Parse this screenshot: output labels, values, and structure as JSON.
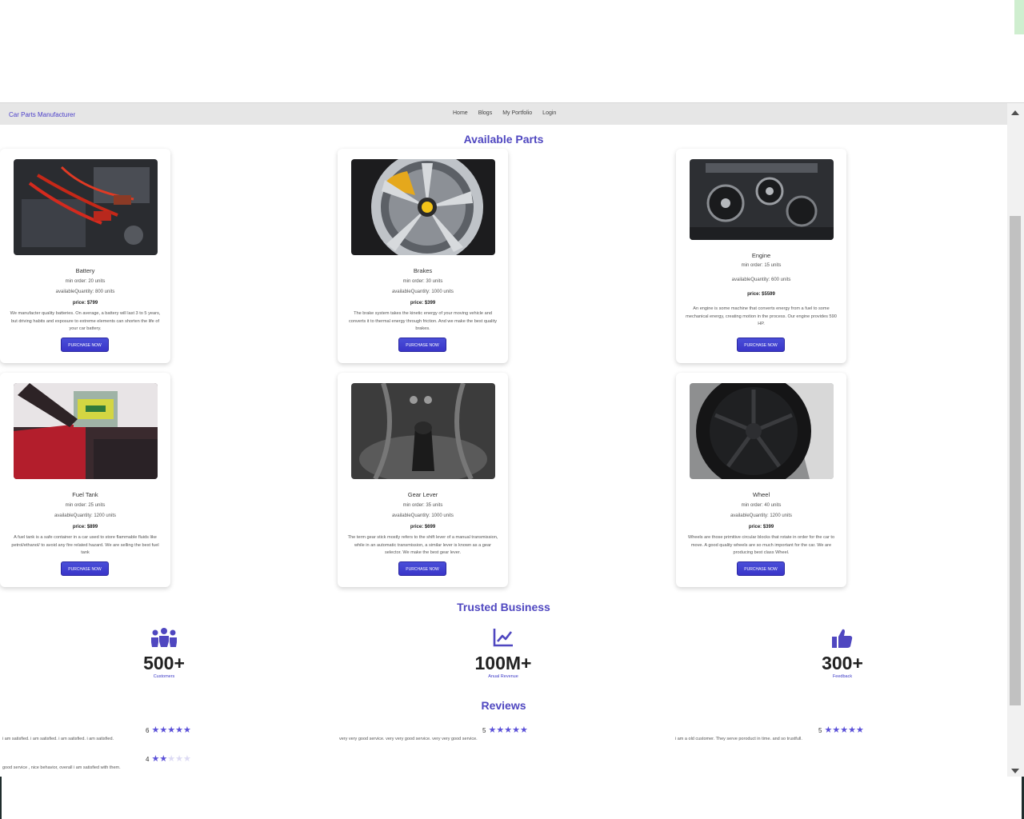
{
  "nav": {
    "brand": "Car Parts Manufacturer",
    "links": [
      "Home",
      "Blogs",
      "My Portfolio",
      "Login"
    ]
  },
  "parts_section": {
    "title": "Available Parts"
  },
  "parts": [
    {
      "name": "Battery",
      "min_order": "min order: 20 units",
      "available": "availableQuantity: 800 units",
      "price": "price: $799",
      "desc": "We manufacter quality batteries. On average, a battery will last 3 to 5 years, but driving habits and exposure to extreme elements can shorten the life of your car battery.",
      "button": "PURCHASE NOW"
    },
    {
      "name": "Brakes",
      "min_order": "min order: 30 units",
      "available": "availableQuantity: 1000 units",
      "price": "price: $399",
      "desc": "The brake system takes the kinetic energy of your moving vehicle and converts it to thermal energy through friction. And we make the best quality brakes.",
      "button": "PURCHASE NOW"
    },
    {
      "name": "Engine",
      "min_order": "min order: 15 units",
      "available": "availableQuantity: 600 units",
      "price": "price: $5599",
      "desc": "An engine is some machine that converts energy from a fuel to some mechanical energy, creating motion in the process. Our engine provides 590 HP.",
      "button": "PURCHASE NOW"
    },
    {
      "name": "Fuel Tank",
      "min_order": "min order: 25 units",
      "available": "availableQuantity: 1200 units",
      "price": "price: $899",
      "desc": "A fuel tank is a safe container in a car used to store flammable fluids like petrol/ethanol/ to avoid any fire related hazard. We are selling the best fuel tank",
      "button": "PURCHASE NOW"
    },
    {
      "name": "Gear Lever",
      "min_order": "min order: 35 units",
      "available": "availableQuantity: 1000 units",
      "price": "price: $699",
      "desc": "The term gear stick mostly refers to the shift lever of a manual transmission, while in an automatic transmission, a similar lever is known as a gear selector. We make the best gear lever.",
      "button": "PURCHASE NOW"
    },
    {
      "name": "Wheel",
      "min_order": "min order: 40 units",
      "available": "availableQuantity: 1200 units",
      "price": "price: $399",
      "desc": "Wheels are those primitive circular blocks that rotate in order for the car to move. A good quality wheels are so much important for the car. We are producing best class Wheel.",
      "button": "PURCHASE NOW"
    }
  ],
  "trusted": {
    "title": "Trusted Business",
    "stats": [
      {
        "icon": "users-icon",
        "value": "500+",
        "label": "Customers"
      },
      {
        "icon": "chart-line-icon",
        "value": "100M+",
        "label": "Anual Revenue"
      },
      {
        "icon": "thumbs-up-icon",
        "value": "300+",
        "label": "Feedback"
      }
    ]
  },
  "reviews": {
    "title": "Reviews",
    "items": [
      {
        "rating": "6",
        "stars": 5,
        "text": "i am satisfied. i am satisfied. i am satisfied. i am satisfied."
      },
      {
        "rating": "5",
        "stars": 5,
        "text": "very very good service. very very good service. very very good service."
      },
      {
        "rating": "5",
        "stars": 5,
        "text": "i am a old customer. They serve poroduct in time. and so trustfull."
      },
      {
        "rating": "4",
        "stars": 2,
        "text": "good service , nice behavior, overall i am satisfied with them."
      }
    ]
  },
  "colors": {
    "accent": "#4f47c0",
    "button": "#3a35c9",
    "navbar": "#e6e6e6"
  }
}
